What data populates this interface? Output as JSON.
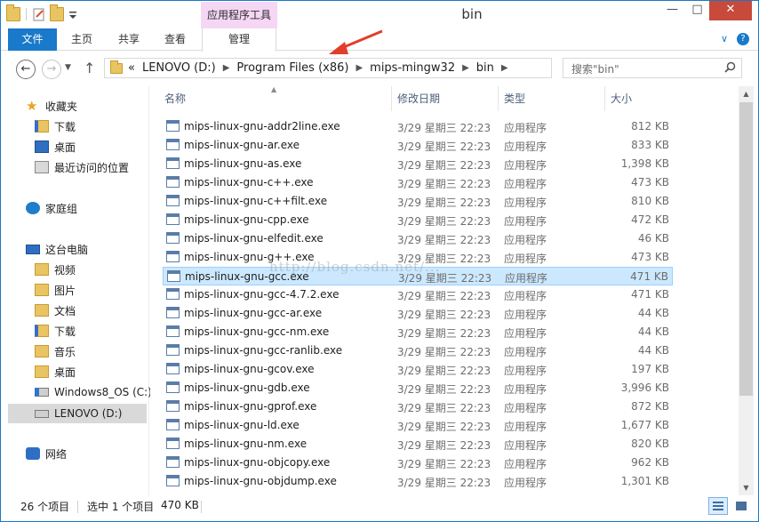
{
  "window": {
    "title": "bin",
    "context_tab": "应用程序工具"
  },
  "ribbon": {
    "tabs": [
      {
        "label": "文件"
      },
      {
        "label": "主页"
      },
      {
        "label": "共享"
      },
      {
        "label": "查看"
      },
      {
        "label": "管理"
      }
    ]
  },
  "address": {
    "crumbs": [
      "LENOVO (D:)",
      "Program Files (x86)",
      "mips-mingw32",
      "bin"
    ],
    "overflow": "«"
  },
  "search": {
    "placeholder": "搜索\"bin\""
  },
  "navpane": {
    "favorites": "收藏夹",
    "downloads": "下载",
    "desktop": "桌面",
    "recent": "最近访问的位置",
    "homegroup": "家庭组",
    "thispc": "这台电脑",
    "videos": "视频",
    "pictures": "图片",
    "documents": "文档",
    "downloads2": "下载",
    "music": "音乐",
    "desktop2": "桌面",
    "drive_c": "Windows8_OS (C:)",
    "drive_d": "LENOVO (D:)",
    "network": "网络"
  },
  "columns": {
    "name": "名称",
    "date": "修改日期",
    "type": "类型",
    "size": "大小"
  },
  "files": [
    {
      "name": "mips-linux-gnu-addr2line.exe",
      "date": "3/29 星期三 22:23",
      "type": "应用程序",
      "size": "812 KB"
    },
    {
      "name": "mips-linux-gnu-ar.exe",
      "date": "3/29 星期三 22:23",
      "type": "应用程序",
      "size": "833 KB"
    },
    {
      "name": "mips-linux-gnu-as.exe",
      "date": "3/29 星期三 22:23",
      "type": "应用程序",
      "size": "1,398 KB"
    },
    {
      "name": "mips-linux-gnu-c++.exe",
      "date": "3/29 星期三 22:23",
      "type": "应用程序",
      "size": "473 KB"
    },
    {
      "name": "mips-linux-gnu-c++filt.exe",
      "date": "3/29 星期三 22:23",
      "type": "应用程序",
      "size": "810 KB"
    },
    {
      "name": "mips-linux-gnu-cpp.exe",
      "date": "3/29 星期三 22:23",
      "type": "应用程序",
      "size": "472 KB"
    },
    {
      "name": "mips-linux-gnu-elfedit.exe",
      "date": "3/29 星期三 22:23",
      "type": "应用程序",
      "size": "46 KB"
    },
    {
      "name": "mips-linux-gnu-g++.exe",
      "date": "3/29 星期三 22:23",
      "type": "应用程序",
      "size": "473 KB"
    },
    {
      "name": "mips-linux-gnu-gcc.exe",
      "date": "3/29 星期三 22:23",
      "type": "应用程序",
      "size": "471 KB",
      "selected": true
    },
    {
      "name": "mips-linux-gnu-gcc-4.7.2.exe",
      "date": "3/29 星期三 22:23",
      "type": "应用程序",
      "size": "471 KB"
    },
    {
      "name": "mips-linux-gnu-gcc-ar.exe",
      "date": "3/29 星期三 22:23",
      "type": "应用程序",
      "size": "44 KB"
    },
    {
      "name": "mips-linux-gnu-gcc-nm.exe",
      "date": "3/29 星期三 22:23",
      "type": "应用程序",
      "size": "44 KB"
    },
    {
      "name": "mips-linux-gnu-gcc-ranlib.exe",
      "date": "3/29 星期三 22:23",
      "type": "应用程序",
      "size": "44 KB"
    },
    {
      "name": "mips-linux-gnu-gcov.exe",
      "date": "3/29 星期三 22:23",
      "type": "应用程序",
      "size": "197 KB"
    },
    {
      "name": "mips-linux-gnu-gdb.exe",
      "date": "3/29 星期三 22:23",
      "type": "应用程序",
      "size": "3,996 KB"
    },
    {
      "name": "mips-linux-gnu-gprof.exe",
      "date": "3/29 星期三 22:23",
      "type": "应用程序",
      "size": "872 KB"
    },
    {
      "name": "mips-linux-gnu-ld.exe",
      "date": "3/29 星期三 22:23",
      "type": "应用程序",
      "size": "1,677 KB"
    },
    {
      "name": "mips-linux-gnu-nm.exe",
      "date": "3/29 星期三 22:23",
      "type": "应用程序",
      "size": "820 KB"
    },
    {
      "name": "mips-linux-gnu-objcopy.exe",
      "date": "3/29 星期三 22:23",
      "type": "应用程序",
      "size": "962 KB"
    },
    {
      "name": "mips-linux-gnu-objdump.exe",
      "date": "3/29 星期三 22:23",
      "type": "应用程序",
      "size": "1,301 KB"
    }
  ],
  "watermark": "http://blog.csdn.net/...",
  "status": {
    "count": "26 个项目",
    "selection": "选中 1 个项目",
    "selection_size": "470 KB"
  },
  "colors": {
    "accent": "#1979ca",
    "context_tab": "#f5d7f5",
    "close": "#c74a3b",
    "selection": "#cce8ff",
    "annotation_arrow": "#e23d2d"
  }
}
